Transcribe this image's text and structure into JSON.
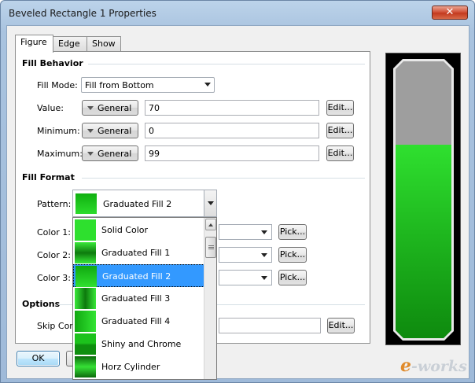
{
  "window": {
    "title": "Beveled Rectangle 1 Properties",
    "close_glyph": "✕"
  },
  "tabs": [
    {
      "label": "Figure",
      "active": true
    },
    {
      "label": "Edge",
      "active": false
    },
    {
      "label": "Show",
      "active": false
    }
  ],
  "fill_behavior": {
    "section_title": "Fill Behavior",
    "fill_mode_label": "Fill Mode:",
    "fill_mode_value": "Fill from Bottom",
    "rows": [
      {
        "label": "Value:",
        "type": "General",
        "value": "70",
        "button": "Edit..."
      },
      {
        "label": "Minimum:",
        "type": "General",
        "value": "0",
        "button": "Edit..."
      },
      {
        "label": "Maximum:",
        "type": "General",
        "value": "99",
        "button": "Edit..."
      }
    ]
  },
  "fill_format": {
    "section_title": "Fill Format",
    "pattern_label": "Pattern:",
    "pattern_value": "Graduated Fill 2",
    "colors": [
      {
        "label": "Color 1:",
        "button": "Pick..."
      },
      {
        "label": "Color 2:",
        "button": "Pick..."
      },
      {
        "label": "Color 3:",
        "button": "Pick..."
      }
    ]
  },
  "pattern_dropdown": {
    "items": [
      {
        "label": "Solid Color",
        "selected": false
      },
      {
        "label": "Graduated Fill 1",
        "selected": false
      },
      {
        "label": "Graduated Fill 2",
        "selected": true
      },
      {
        "label": "Graduated Fill 3",
        "selected": false
      },
      {
        "label": "Graduated Fill 4",
        "selected": false
      },
      {
        "label": "Shiny and Chrome",
        "selected": false
      },
      {
        "label": "Horz Cylinder",
        "selected": false
      }
    ]
  },
  "options": {
    "section_title": "Options",
    "skip_label": "Skip Corn",
    "edit_button": "Edit..."
  },
  "preview": {
    "fill_fraction": 0.7,
    "fill_color": "#22c022",
    "empty_color": "#9e9e9e"
  },
  "buttons": {
    "ok": "OK"
  },
  "watermark": {
    "e": "e",
    "rest": "-works"
  },
  "colors": {
    "selection": "#3399ff",
    "accent_green": "#1fb81f"
  }
}
